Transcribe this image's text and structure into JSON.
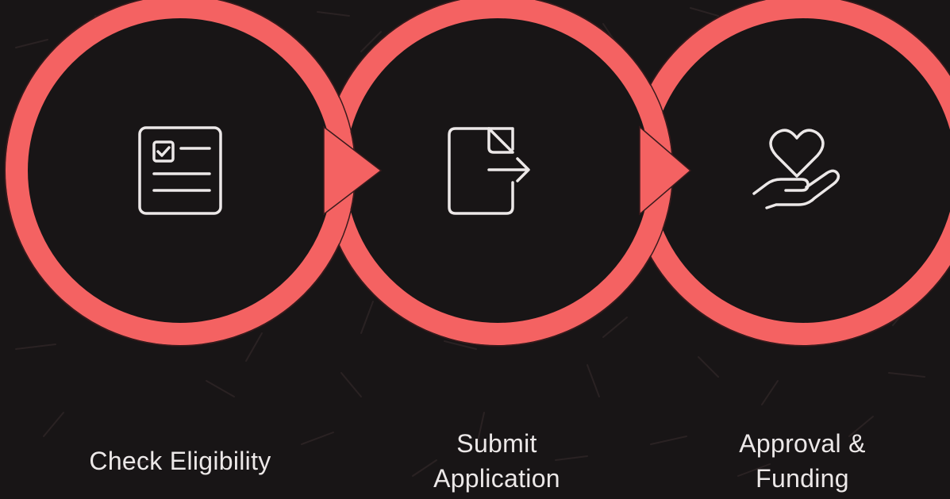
{
  "theme": {
    "background": "#181516",
    "ring_color": "#f46262",
    "icon_color": "#ece8e8",
    "label_color": "#ece8e8"
  },
  "steps": [
    {
      "label_lines": [
        "Check Eligibility"
      ],
      "icon": "checklist-document-icon"
    },
    {
      "label_lines": [
        "Submit",
        "Application"
      ],
      "icon": "document-export-icon"
    },
    {
      "label_lines": [
        "Approval &",
        "Funding"
      ],
      "icon": "heart-in-hand-icon"
    }
  ]
}
